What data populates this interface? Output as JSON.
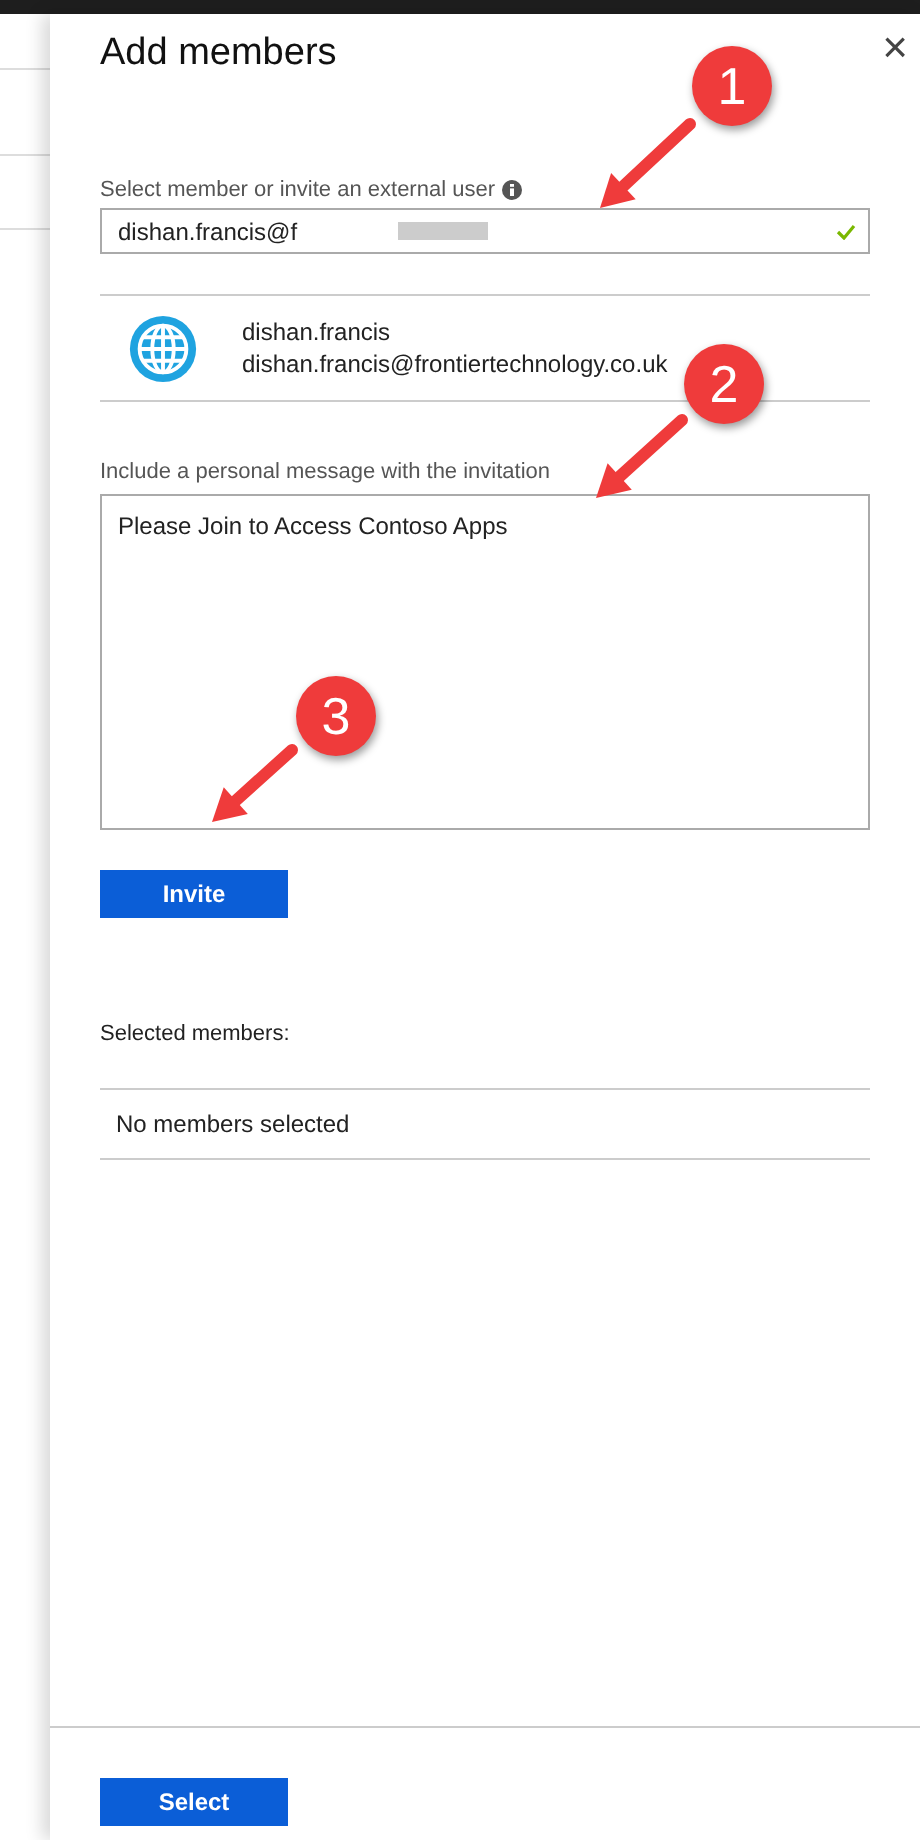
{
  "panel": {
    "title": "Add members",
    "close": "×"
  },
  "member_field": {
    "label": "Select member or invite an external user",
    "value": "dishan.francis@f",
    "valid": true
  },
  "suggestion": {
    "name": "dishan.francis",
    "email": "dishan.francis@frontiertechnology.co.uk"
  },
  "message": {
    "label": "Include a personal message with the invitation",
    "value": "Please Join to Access Contoso Apps"
  },
  "invite_button": "Invite",
  "selected_members": {
    "label": "Selected members:",
    "empty_text": "No members selected"
  },
  "select_button": "Select",
  "annotations": [
    {
      "number": "1"
    },
    {
      "number": "2"
    },
    {
      "number": "3"
    }
  ]
}
